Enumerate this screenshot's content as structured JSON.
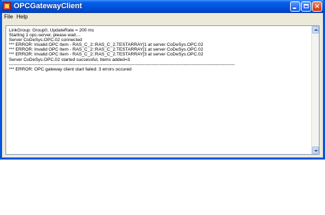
{
  "window": {
    "title": "OPCGatewayClient",
    "icon": "app-icon",
    "buttons": {
      "minimize": "minimize-icon",
      "maximize": "maximize-icon",
      "close": "×"
    }
  },
  "menu": {
    "items": [
      {
        "label": "File"
      },
      {
        "label": "Help"
      }
    ]
  },
  "log": {
    "lines": [
      "LinkGroup: Group0, UpdateRate = 200 ms",
      "Starting 1 opc-server, please wait....",
      "Server CoDeSys.OPC.02 connected",
      "*** ERROR: Invalid OPC Item - RAS_C_2::RAS_C_2.TESTARRAY[1 at server CoDeSys.OPC.02",
      "*** ERROR: Invalid OPC Item - RAS_C_2::RAS_C_2.TESTARRAY[1 at server CoDeSys.OPC.02",
      "*** ERROR: Invalid OPC Item - RAS_C_2::RAS_C_2.TESTARRAY[3 at server CoDeSys.OPC.02",
      "Server CoDeSys.OPC.02 started successful, Items added=3",
      "------------------------------------------------------------------------------------------------------------------------------------------------------",
      "*** ERROR: OPC gateway client start failed: 3 errors occured"
    ]
  },
  "colors": {
    "titlebar": "#0054e3",
    "window_face": "#ece9d8",
    "client_background": "#ffffff",
    "text": "#000000"
  }
}
